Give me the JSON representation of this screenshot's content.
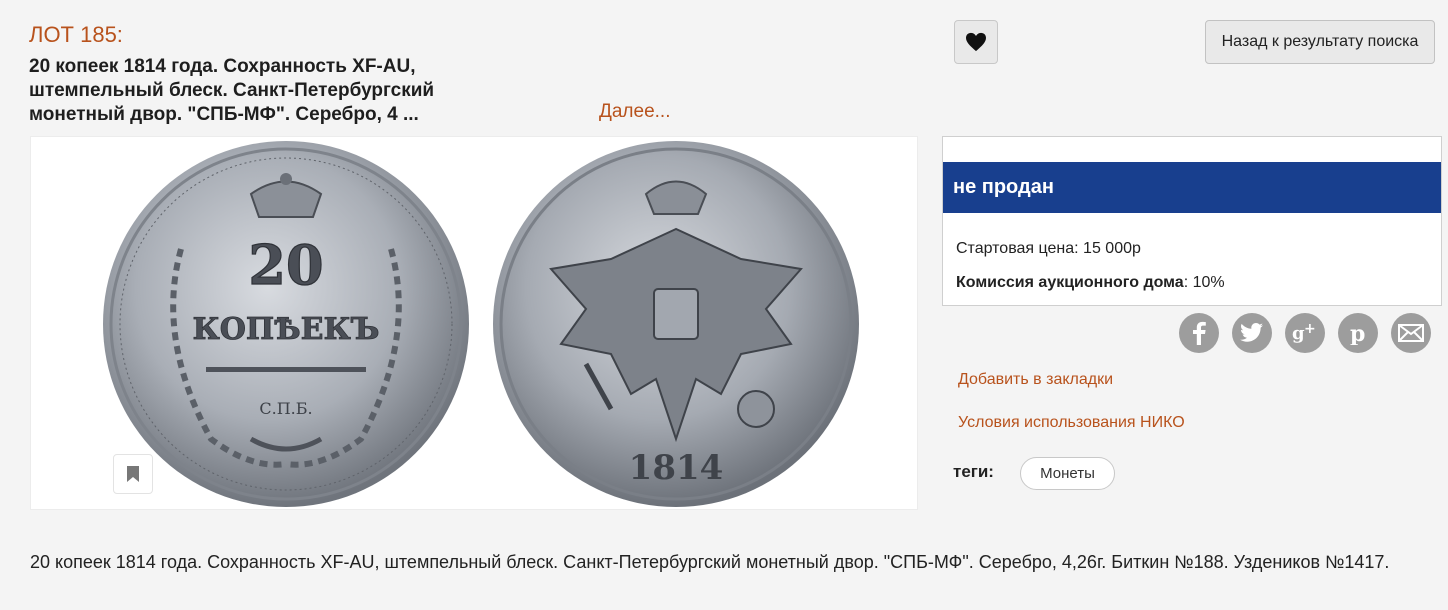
{
  "lot": {
    "label": "ЛОТ 185:",
    "title": "20 копеек 1814 года. Сохранность XF-AU, штемпельный блеск. Санкт-Петербургский монетный двор. \"СПБ-МФ\". Серебро, 4 ...",
    "more_link": "Далее..."
  },
  "header": {
    "back_label": "Назад к результату поиска",
    "favorite_icon": "heart-icon"
  },
  "images": {
    "reverse": {
      "denomination": "20",
      "word": "КОПѢЕКЪ",
      "mint": "С.П.Б."
    },
    "obverse": {
      "year": "1814"
    },
    "bookmark_icon": "bookmark-icon"
  },
  "status": {
    "text": "не продан",
    "color": "#183f8e",
    "start_price_label": "Стартовая цена:",
    "start_price_value": "15 000р",
    "commission_label": "Комиссия аукционного дома",
    "commission_value": ": 10%"
  },
  "social": [
    "facebook-icon",
    "twitter-icon",
    "google-plus-icon",
    "pinterest-icon",
    "mail-icon"
  ],
  "links": {
    "bookmarks": "Добавить в закладки",
    "terms": "Условия использования НИКО"
  },
  "tags": {
    "label": "теги:",
    "items": [
      "Монеты"
    ]
  },
  "description": "20 копеек 1814 года. Сохранность XF-AU, штемпельный блеск. Санкт-Петербургский монетный двор. \"СПБ-МФ\". Серебро, 4,26г. Биткин №188. Уздеников №1417.",
  "accent_color": "#b8521c"
}
